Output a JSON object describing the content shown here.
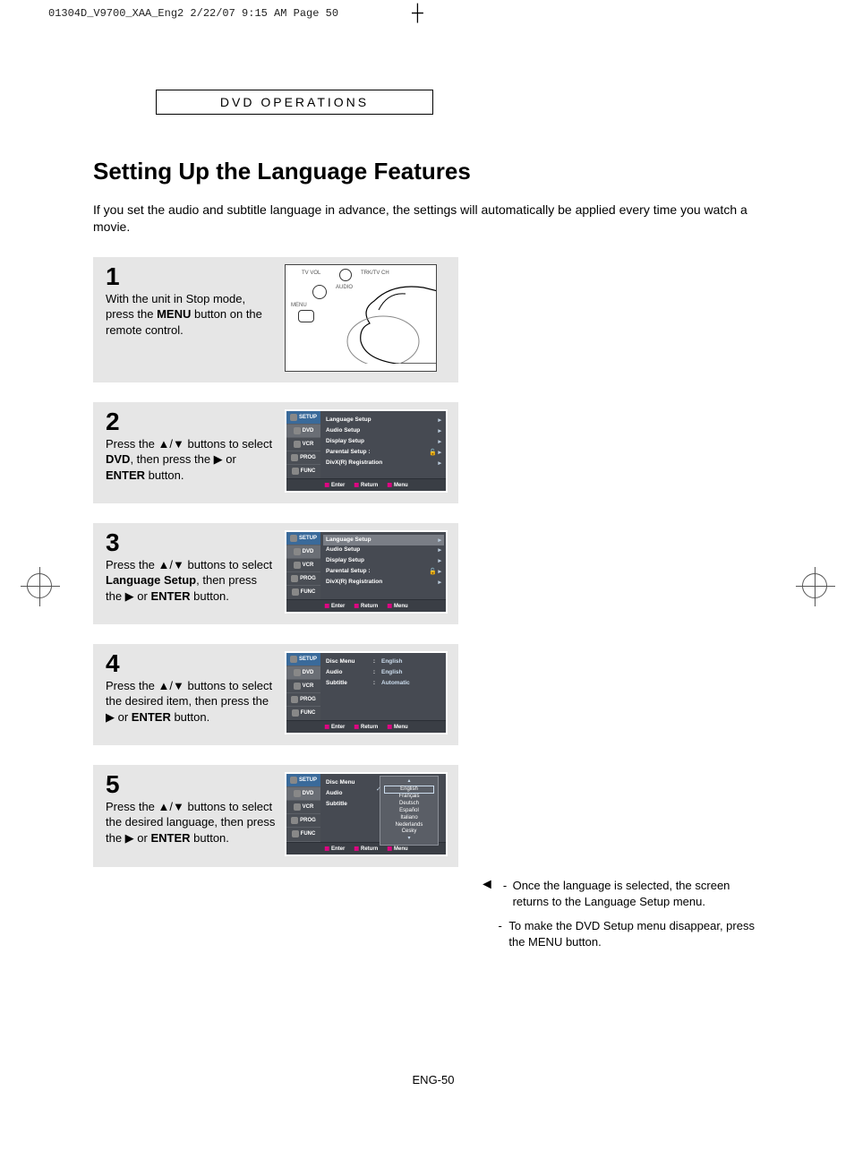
{
  "print_header": "01304D_V9700_XAA_Eng2  2/22/07  9:15 AM  Page 50",
  "section_label": "DVD OPERATIONS",
  "title": "Setting Up the Language Features",
  "intro": "If you set the audio and subtitle language in advance, the settings will automatically be applied every time you watch a movie.",
  "steps": {
    "s1": {
      "num": "1",
      "text_a": "With the unit in Stop mode, press the ",
      "bold_a": "MENU",
      "text_b": " button on the remote control."
    },
    "s2": {
      "num": "2",
      "text_a": "Press the ▲/▼ buttons to select ",
      "bold_a": "DVD",
      "text_b": ", then press the ▶ or ",
      "bold_b": "ENTER",
      "text_c": " button."
    },
    "s3": {
      "num": "3",
      "text_a": "Press the ▲/▼ buttons to select ",
      "bold_a": "Language Setup",
      "text_b": ", then press the ▶ or ",
      "bold_b": "ENTER",
      "text_c": " button."
    },
    "s4": {
      "num": "4",
      "text_a": "Press the ▲/▼ buttons to select the desired item, then press the ▶ or ",
      "bold_a": "ENTER",
      "text_b": " button."
    },
    "s5": {
      "num": "5",
      "text_a": "Press the ▲/▼ buttons to select the desired language, then press the ▶ or ",
      "bold_a": "ENTER",
      "text_b": " button."
    }
  },
  "remote": {
    "tvvol": "TV VOL",
    "trk": "TRK/TV CH",
    "audio": "AUDIO",
    "menu": "MENU"
  },
  "osd": {
    "tabs": {
      "setup": "SETUP",
      "dvd": "DVD",
      "vcr": "VCR",
      "prog": "PROG",
      "func": "FUNC"
    },
    "menu_items": {
      "lang": "Language  Setup",
      "audio": "Audio  Setup",
      "display": "Display  Setup",
      "parental": "Parental  Setup :",
      "divx": "DivX(R) Registration"
    },
    "lang_menu": {
      "disc": "Disc Menu",
      "audio": "Audio",
      "subtitle": "Subtitle",
      "v_english": "English",
      "v_auto": "Automatic"
    },
    "lang_list": {
      "english": "English",
      "francais": "Français",
      "deutsch": "Deutsch",
      "espanol": "Español",
      "italiano": "Italiano",
      "nederlands": "Nederlands",
      "cesky": "Cesky"
    },
    "foot": {
      "enter": "Enter",
      "return": "Return",
      "menu": "Menu"
    }
  },
  "notes": {
    "n1": "Once the language is selected, the screen returns to the Language Setup menu.",
    "n2": "To make the DVD Setup menu disappear, press the MENU button."
  },
  "page_num": "ENG-50"
}
